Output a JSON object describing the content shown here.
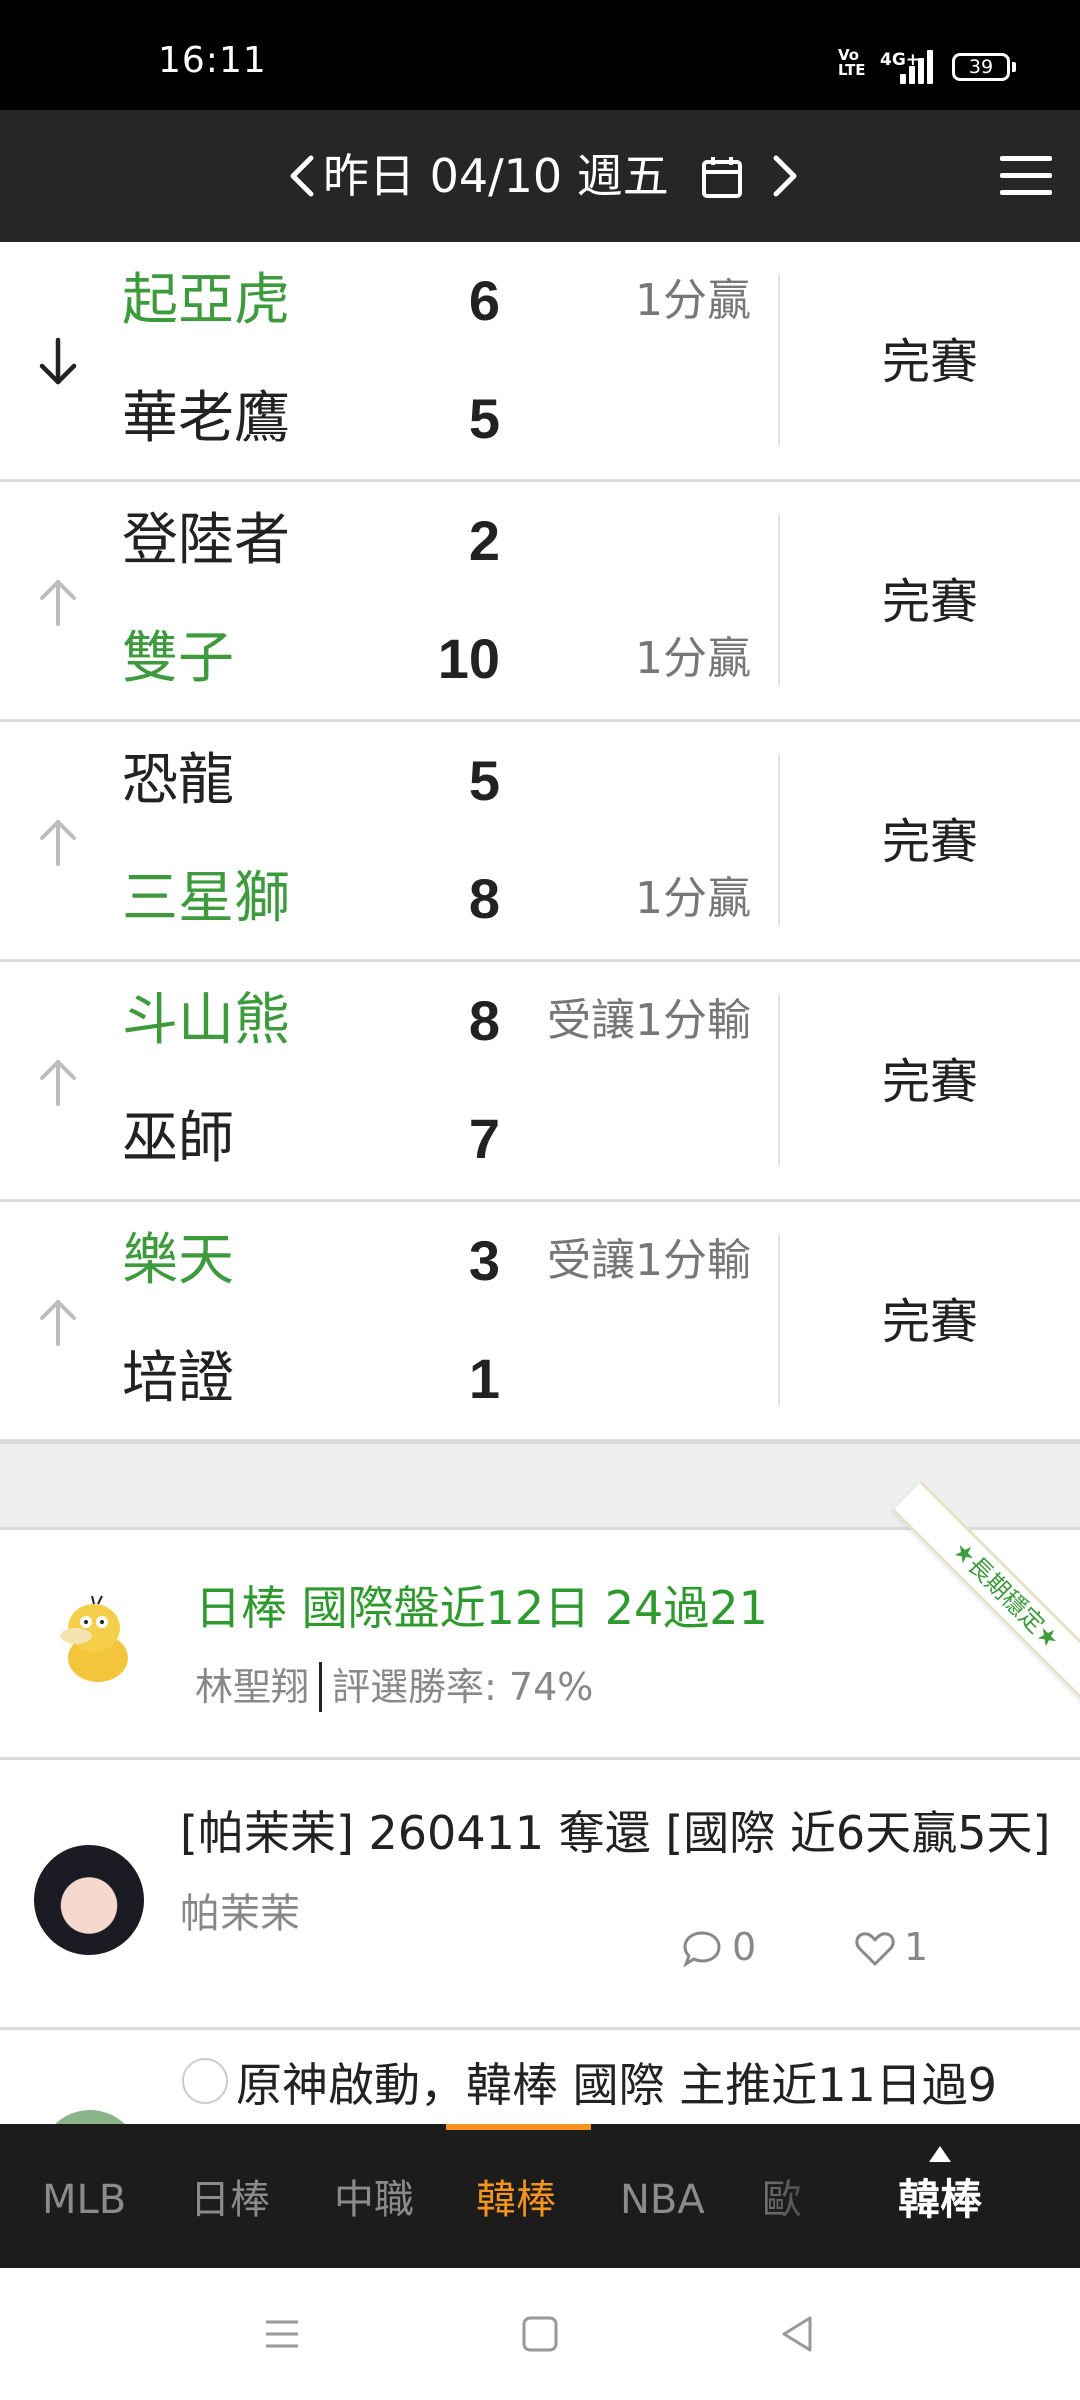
{
  "status_bar": {
    "time": "16:11",
    "volte": "Vo LTE",
    "network": "4G+",
    "battery": "39"
  },
  "header": {
    "title": "昨日 04/10 週五",
    "prev_icon": "chevron-left-icon",
    "next_icon": "chevron-right-icon",
    "calendar_icon": "calendar-icon",
    "menu_icon": "hamburger-menu-icon"
  },
  "games": [
    {
      "indicator": "arrow-down",
      "top": {
        "team": "起亞虎",
        "score": "6",
        "result": "1分贏",
        "winner": true
      },
      "bottom": {
        "team": "華老鷹",
        "score": "5",
        "result": "",
        "winner": false
      },
      "status": "完賽"
    },
    {
      "indicator": "arrow-up",
      "top": {
        "team": "登陸者",
        "score": "2",
        "result": "",
        "winner": false
      },
      "bottom": {
        "team": "雙子",
        "score": "10",
        "result": "1分贏",
        "winner": true
      },
      "status": "完賽"
    },
    {
      "indicator": "arrow-up",
      "top": {
        "team": "恐龍",
        "score": "5",
        "result": "",
        "winner": false
      },
      "bottom": {
        "team": "三星獅",
        "score": "8",
        "result": "1分贏",
        "winner": true
      },
      "status": "完賽"
    },
    {
      "indicator": "arrow-up",
      "top": {
        "team": "斗山熊",
        "score": "8",
        "result": "受讓1分輸",
        "winner": true
      },
      "bottom": {
        "team": "巫師",
        "score": "7",
        "result": "",
        "winner": false
      },
      "status": "完賽"
    },
    {
      "indicator": "arrow-up",
      "top": {
        "team": "樂天",
        "score": "3",
        "result": "受讓1分輸",
        "winner": true
      },
      "bottom": {
        "team": "培證",
        "score": "1",
        "result": "",
        "winner": false
      },
      "status": "完賽"
    }
  ],
  "posts": [
    {
      "title": "日棒 國際盤近12日 24過21",
      "author": "林聖翔",
      "meta": "評選勝率: 74%",
      "ribbon": "★長期穩定★"
    },
    {
      "title": "[帕茉茉] 260411 奪還 [國際 近6天贏5天]",
      "author": "帕茉茉",
      "comments": "0",
      "likes": "1"
    },
    {
      "title": "原神啟動，韓棒 國際 主推近11日過9"
    }
  ],
  "tabs": [
    {
      "label": "MLB",
      "active": false
    },
    {
      "label": "日棒",
      "active": false
    },
    {
      "label": "中職",
      "active": false
    },
    {
      "label": "韓棒",
      "active": true
    },
    {
      "label": "NBA",
      "active": false
    },
    {
      "label": "歐",
      "active": false
    }
  ],
  "tab_more_label": "韓棒",
  "colors": {
    "win": "#3d9a3d",
    "accent": "#f7941d",
    "header_bg": "#262626",
    "tabbar_bg": "#1c1c1c"
  }
}
